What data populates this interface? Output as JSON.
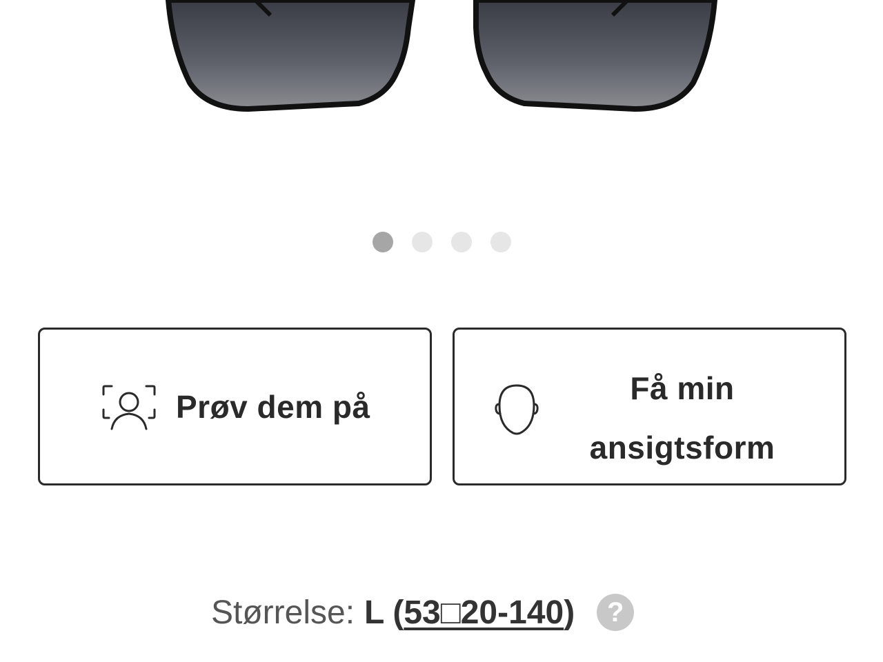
{
  "carousel": {
    "slide_count": 4,
    "active_index": 0
  },
  "actions": {
    "try_on_label": "Prøv dem på",
    "face_shape_label_line1": "Få min",
    "face_shape_label_line2": "ansigtsform"
  },
  "size": {
    "label": "Størrelse:",
    "value": "L",
    "open_paren": "(",
    "dimensions": "53□20-140",
    "close_paren": ")",
    "help_symbol": "?"
  },
  "colors": {
    "border": "#2a2a2a",
    "dot_active": "#a6a6a6",
    "dot_inactive": "#e6e6e6",
    "help_bg": "#c8c8c8"
  },
  "icons": {
    "try_on": "face-scan-icon",
    "face_shape": "face-outline-icon",
    "help": "question-circle-icon"
  }
}
